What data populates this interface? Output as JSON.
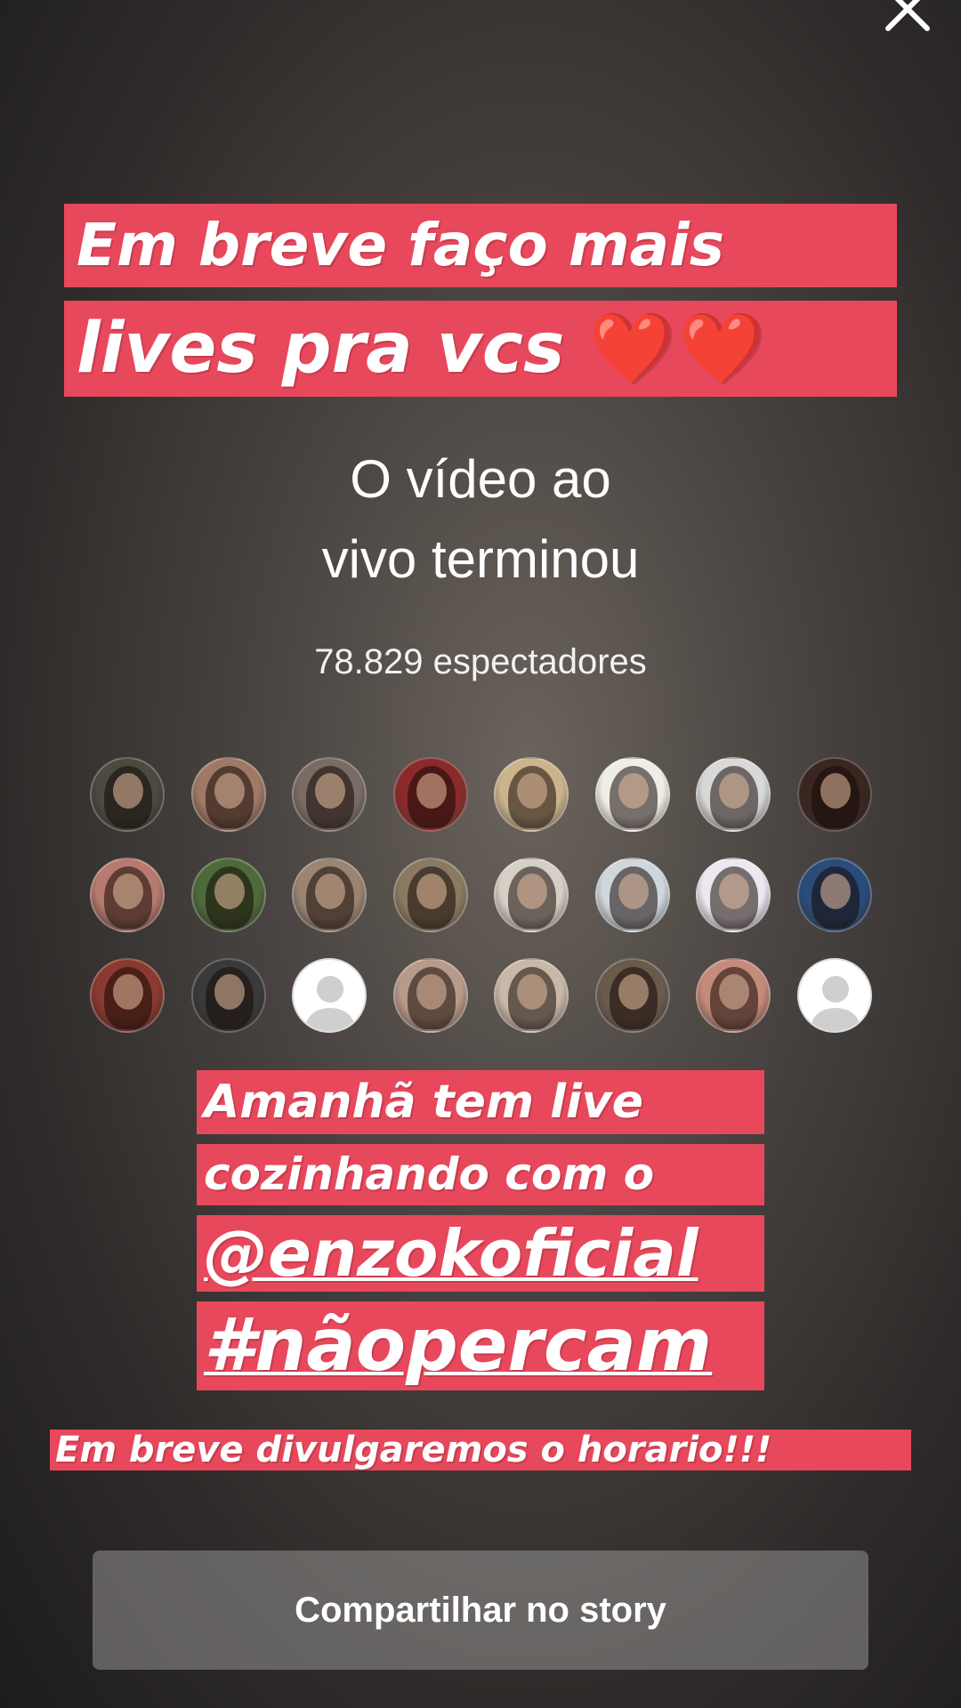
{
  "captions": {
    "line1": "Em breve faço mais",
    "line2_text": "lives pra vcs",
    "line2_hearts": "❤️❤️",
    "m1": "Amanhã tem live",
    "m2": "cozinhando com o",
    "m3": "@enzokoficial",
    "m4": "#nãopercam",
    "small": "Em breve divulgaremos o horario!!!"
  },
  "live": {
    "ended_line1": "O vídeo ao",
    "ended_line2": "vivo terminou",
    "viewers": "78.829 espectadores"
  },
  "viewer_avatars": [
    {
      "color": "#4a4a40"
    },
    {
      "color": "#a07866"
    },
    {
      "color": "#7a6c64"
    },
    {
      "color": "#8a2a2a"
    },
    {
      "color": "#c9b48c"
    },
    {
      "color": "#f0ece6"
    },
    {
      "color": "#d8d8d8"
    },
    {
      "color": "#3a2620"
    },
    {
      "color": "#b67a6e"
    },
    {
      "color": "#4e6a3a"
    },
    {
      "color": "#9a8472"
    },
    {
      "color": "#8a7a62"
    },
    {
      "color": "#d6cfc6"
    },
    {
      "color": "#cfd6dc"
    },
    {
      "color": "#ece8f0"
    },
    {
      "color": "#2a4c7a"
    },
    {
      "color": "#8a3a30"
    },
    {
      "color": "#3a3a3a"
    },
    {
      "placeholder": true
    },
    {
      "color": "#b89a8a"
    },
    {
      "color": "#c8b8a8"
    },
    {
      "color": "#6a5a4c"
    },
    {
      "color": "#c48a7a"
    },
    {
      "placeholder": true
    }
  ],
  "share_button": "Compartilhar no story",
  "colors": {
    "caption_bg": "#e8485c",
    "button_bg": "rgba(150,148,145,0.55)"
  },
  "icons": {
    "close": "close-icon",
    "placeholder_avatar": "default-user-icon"
  }
}
